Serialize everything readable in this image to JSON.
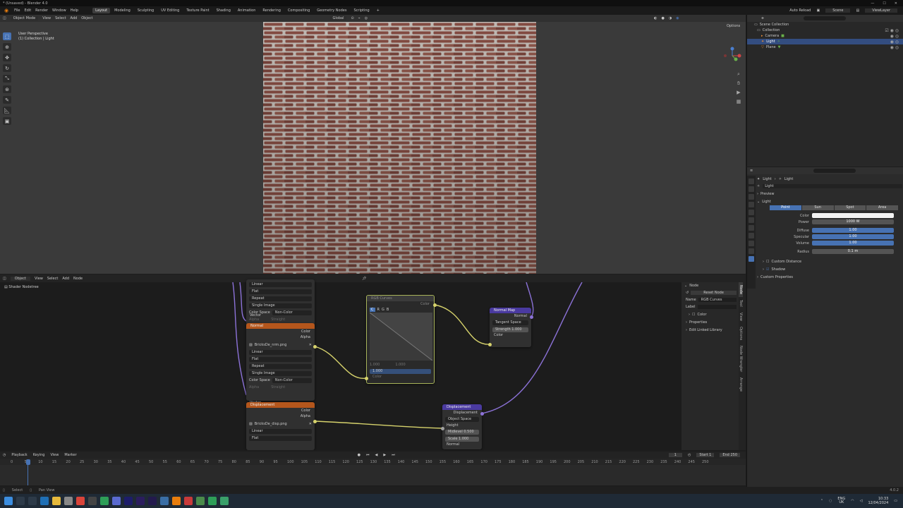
{
  "window": {
    "title": "* (Unsaved) - Blender 4.0"
  },
  "menu": [
    "File",
    "Edit",
    "Render",
    "Window",
    "Help"
  ],
  "workspaces": [
    "Layout",
    "Modeling",
    "Sculpting",
    "UV Editing",
    "Texture Paint",
    "Shading",
    "Animation",
    "Rendering",
    "Compositing",
    "Geometry Nodes",
    "Scripting"
  ],
  "active_workspace": "Layout",
  "topbar_right": {
    "scene": "Scene",
    "view_layer": "ViewLayer",
    "auto": "Auto Reload"
  },
  "viewport": {
    "mode": "Object Mode",
    "menus": [
      "View",
      "Select",
      "Add",
      "Object"
    ],
    "orientation": "Global",
    "options": "Options",
    "info_line1": "User Perspective",
    "info_line2": "(1) Collection | Light"
  },
  "outliner": {
    "title": "Scene Collection",
    "items": [
      {
        "label": "Collection",
        "indent": 1
      },
      {
        "label": "Camera",
        "indent": 2
      },
      {
        "label": "Light",
        "indent": 2
      },
      {
        "label": "Plane",
        "indent": 2
      }
    ]
  },
  "properties": {
    "breadcrumb_a": "Light",
    "breadcrumb_b": "Light",
    "datablock": "Light",
    "sections": {
      "preview": "Preview",
      "light": "Light",
      "custom_distance": "Custom Distance",
      "shadow": "Shadow",
      "custom_props": "Custom Properties"
    },
    "light_types": [
      "Point",
      "Sun",
      "Spot",
      "Area"
    ],
    "fields": [
      {
        "label": "Color",
        "value": "",
        "style": "white"
      },
      {
        "label": "Power",
        "value": "1000 W",
        "style": "grey"
      },
      {
        "label": "Diffuse",
        "value": "1.00",
        "style": "blue"
      },
      {
        "label": "Specular",
        "value": "1.00",
        "style": "blue"
      },
      {
        "label": "Volume",
        "value": "1.00",
        "style": "blue"
      },
      {
        "label": "Radius",
        "value": "0.1 m",
        "style": "grey"
      }
    ]
  },
  "node_editor": {
    "type": "Object",
    "menus": [
      "View",
      "Select",
      "Add",
      "Node"
    ],
    "breadcrumb": "Shader Nodetree",
    "img_node_top": {
      "rows": [
        "Linear",
        "Flat",
        "Repeat",
        "Single Image"
      ],
      "color_space_label": "Color Space",
      "color_space": "Non-Color",
      "alpha_label": "Alpha",
      "alpha": "Straight",
      "vector": "Vector"
    },
    "normal_node": {
      "title": "Normal",
      "out_color": "Color",
      "out_alpha": "Alpha",
      "file": "BricksDe_nrm.png",
      "rows": [
        "Linear",
        "Flat",
        "Repeat",
        "Single Image"
      ],
      "color_space_label": "Color Space",
      "color_space": "Non-Color",
      "alpha_label": "Alpha",
      "alpha": "Straight",
      "vector": "Vector"
    },
    "disp_img_node": {
      "title": "Displacement",
      "out_color": "Color",
      "out_alpha": "Alpha",
      "file": "BricksDe_disp.png",
      "rows": [
        "Linear",
        "Flat"
      ]
    },
    "rgb_curves": {
      "title": "RGB Curves",
      "out": "Color",
      "fac_label": "Fac",
      "fac": "1.000",
      "in": "Color",
      "c_min": "1.000",
      "c_max": "1.000"
    },
    "normal_map": {
      "title": "Normal Map",
      "out": "Normal",
      "space": "Tangent Space",
      "strength_label": "Strength",
      "strength": "1.000",
      "in": "Color"
    },
    "displacement": {
      "title": "Displacement",
      "out": "Displacement",
      "space": "Object Space",
      "height": "Height",
      "midlevel_label": "Midlevel",
      "midlevel": "0.500",
      "scale_label": "Scale",
      "scale": "1.000",
      "normal": "Normal"
    },
    "side_panel": {
      "section": "Node",
      "reset": "Reset Node",
      "name_label": "Name",
      "name": "RGB Curves",
      "label_label": "Label",
      "color": "Color",
      "properties": "Properties",
      "edit_linked": "Edit Linked Library"
    },
    "side_tabs": [
      "Node",
      "Tool",
      "View",
      "Options",
      "Node Wrangler",
      "Arrange"
    ]
  },
  "timeline": {
    "menus": [
      "Playback",
      "Keying",
      "View",
      "Marker"
    ],
    "current_frame": "1",
    "start_label": "Start",
    "start": "1",
    "end_label": "End",
    "end": "250",
    "ticks": [
      "0",
      "5",
      "10",
      "15",
      "20",
      "25",
      "30",
      "35",
      "40",
      "45",
      "50",
      "55",
      "60",
      "65",
      "70",
      "75",
      "80",
      "85",
      "90",
      "95",
      "100",
      "105",
      "110",
      "115",
      "120",
      "125",
      "130",
      "135",
      "140",
      "145",
      "150",
      "155",
      "160",
      "165",
      "170",
      "175",
      "180",
      "185",
      "190",
      "195",
      "200",
      "205",
      "210",
      "215",
      "220",
      "225",
      "230",
      "235",
      "240",
      "245",
      "250"
    ]
  },
  "status": {
    "left": "Select",
    "mid": "Pan View",
    "version": "4.0.2"
  },
  "taskbar": {
    "lang": "ENG",
    "region": "UK",
    "time": "10:33",
    "date": "12/04/2024"
  },
  "colors": {
    "accent": "#4772b3",
    "texture_header": "#b4561c",
    "vector_header": "#4a3aa0",
    "curves_border": "#a8b45a",
    "link_yellow": "#d6d26c",
    "link_purple": "#8c72d8"
  }
}
